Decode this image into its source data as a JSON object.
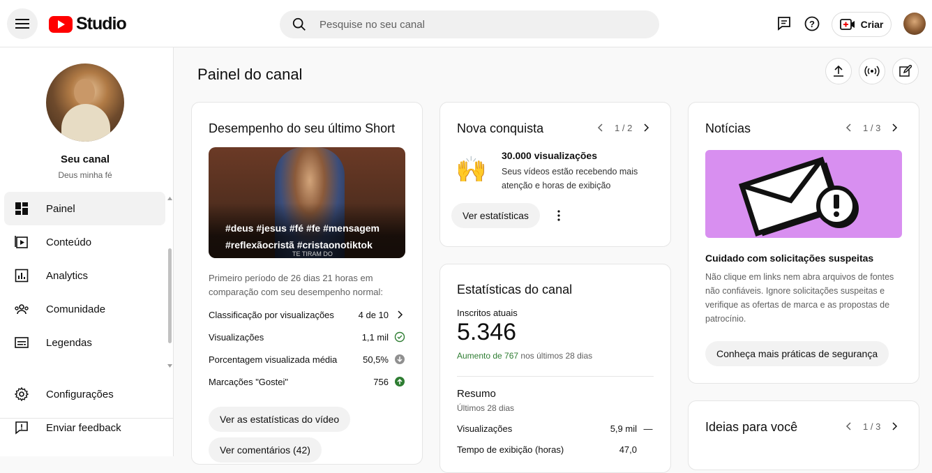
{
  "app": {
    "logo_text": "Studio",
    "brand_color": "#ff0000"
  },
  "search": {
    "placeholder": "Pesquise no seu canal"
  },
  "header": {
    "create_label": "Criar"
  },
  "channel": {
    "name": "Seu canal",
    "subtitle": "Deus minha fé"
  },
  "sidebar": {
    "items": [
      {
        "label": "Painel",
        "icon": "dashboard-icon",
        "active": true
      },
      {
        "label": "Conteúdo",
        "icon": "content-icon"
      },
      {
        "label": "Analytics",
        "icon": "analytics-icon"
      },
      {
        "label": "Comunidade",
        "icon": "community-icon"
      },
      {
        "label": "Legendas",
        "icon": "subtitles-icon"
      }
    ],
    "bottom_items": [
      {
        "label": "Configurações",
        "icon": "gear-icon"
      },
      {
        "label": "Enviar feedback",
        "icon": "feedback-icon"
      }
    ]
  },
  "main": {
    "title": "Painel do canal"
  },
  "short_card": {
    "title": "Desempenho do seu último Short",
    "caption_line1": "#deus #jesus #fé #fe #mensagem",
    "caption_line2": "#reflexãocristã #cristaonotiktok",
    "thumb_small_text": "TE TIRAM DO",
    "period_text": "Primeiro período de 26 dias 21 horas em comparação com seu desempenho normal:",
    "rows": [
      {
        "label": "Classificação por visualizações",
        "value": "4 de 10",
        "indicator": "chevron-right-icon"
      },
      {
        "label": "Visualizações",
        "value": "1,1 mil",
        "indicator": "check-circle-icon"
      },
      {
        "label": "Porcentagem visualizada média",
        "value": "50,5%",
        "indicator": "arrow-down-circle-icon"
      },
      {
        "label": "Marcações \"Gostei\"",
        "value": "756",
        "indicator": "arrow-up-circle-icon"
      }
    ],
    "btn_stats": "Ver as estatísticas do vídeo",
    "btn_comments": "Ver comentários (42)"
  },
  "achievement_card": {
    "title": "Nova conquista",
    "pager": "1 / 2",
    "heading": "30.000 visualizações",
    "text": "Seus vídeos estão recebendo mais atenção e horas de exibição",
    "emoji": "🙌",
    "btn": "Ver estatísticas"
  },
  "stats_card": {
    "title": "Estatísticas do canal",
    "subs_label": "Inscritos atuais",
    "subs_value": "5.346",
    "growth_highlight": "Aumento de 767",
    "growth_rest": "nos últimos 28 dias",
    "summary_title": "Resumo",
    "summary_sub": "Últimos 28 dias",
    "rows": [
      {
        "label": "Visualizações",
        "value": "5,9 mil",
        "trend": "—"
      },
      {
        "label": "Tempo de exibição (horas)",
        "value": "47,0",
        "trend": ""
      }
    ],
    "positive_color": "#2e7d32"
  },
  "news_card": {
    "title": "Notícias",
    "pager": "1 / 3",
    "heading": "Cuidado com solicitações suspeitas",
    "text": "Não clique em links nem abra arquivos de fontes não confiáveis. Ignore solicitações suspeitas e verifique as ofertas de marca e as propostas de patrocínio.",
    "btn": "Conheça mais práticas de segurança",
    "image_bg": "#d88ff0"
  },
  "ideas_card": {
    "title": "Ideias para você",
    "pager": "1 / 3"
  }
}
